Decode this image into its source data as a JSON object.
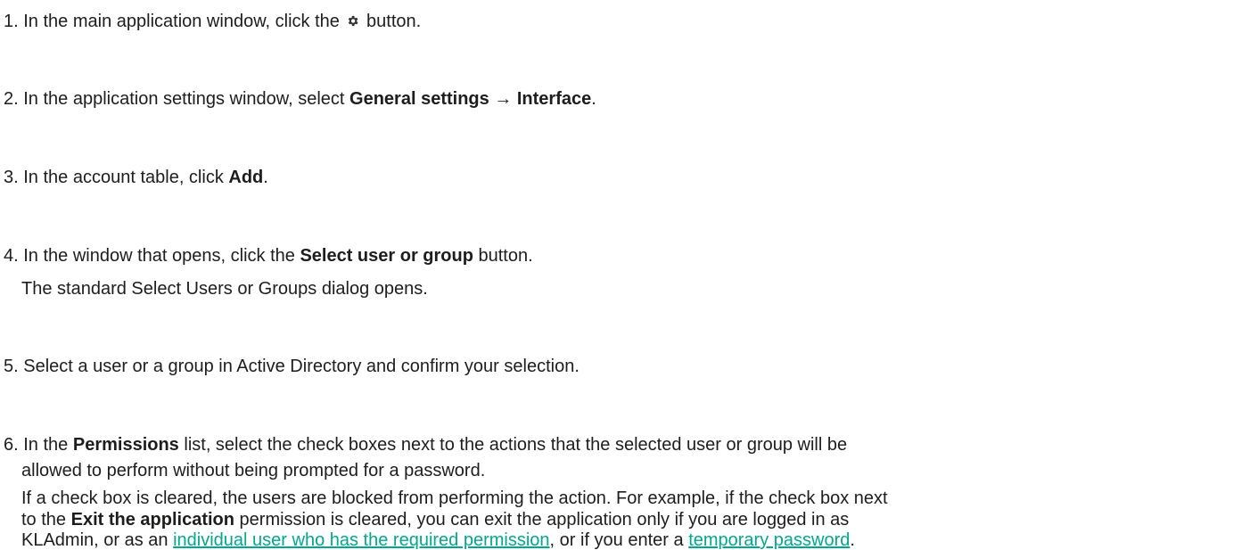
{
  "steps": [
    {
      "number": "1.",
      "pre": "In the main application window, click the",
      "icon": "gear-icon",
      "post": "button."
    },
    {
      "number": "2.",
      "pre": "In the application settings window, select",
      "bold1": "General settings",
      "arrow": "→",
      "bold2": "Interface",
      "post": "."
    },
    {
      "number": "3.",
      "pre": "In the account table, click",
      "bold": "Add",
      "post": "."
    },
    {
      "number": "4.",
      "pre": "In the window that opens, click the",
      "bold": "Select user or group",
      "post": "button.",
      "note": "The standard Select Users or Groups dialog opens."
    },
    {
      "number": "5.",
      "text": "Select a user or a group in Active Directory and confirm your selection."
    },
    {
      "number": "6.",
      "pre": "In the",
      "bold": "Permissions",
      "post": "list, select the check boxes next to the actions that the selected user or group will be",
      "line2": "allowed to perform without being prompted for a password.",
      "para_line1": "If a check box is cleared, the users are blocked from performing the action. For example, if the check box next",
      "para_line2_pre": "to the",
      "para_line2_bold": "Exit the application",
      "para_line2_post": "permission is cleared, you can exit the application only if you are logged in as",
      "para_line3_pre": "KLAdmin, or as an",
      "para_link1": "individual user who has the required permission",
      "para_line3_mid": ", or if you enter a",
      "para_link2": "temporary password",
      "para_line3_end": "."
    }
  ],
  "colors": {
    "text": "#1d1d1b",
    "link": "#00a88e"
  }
}
